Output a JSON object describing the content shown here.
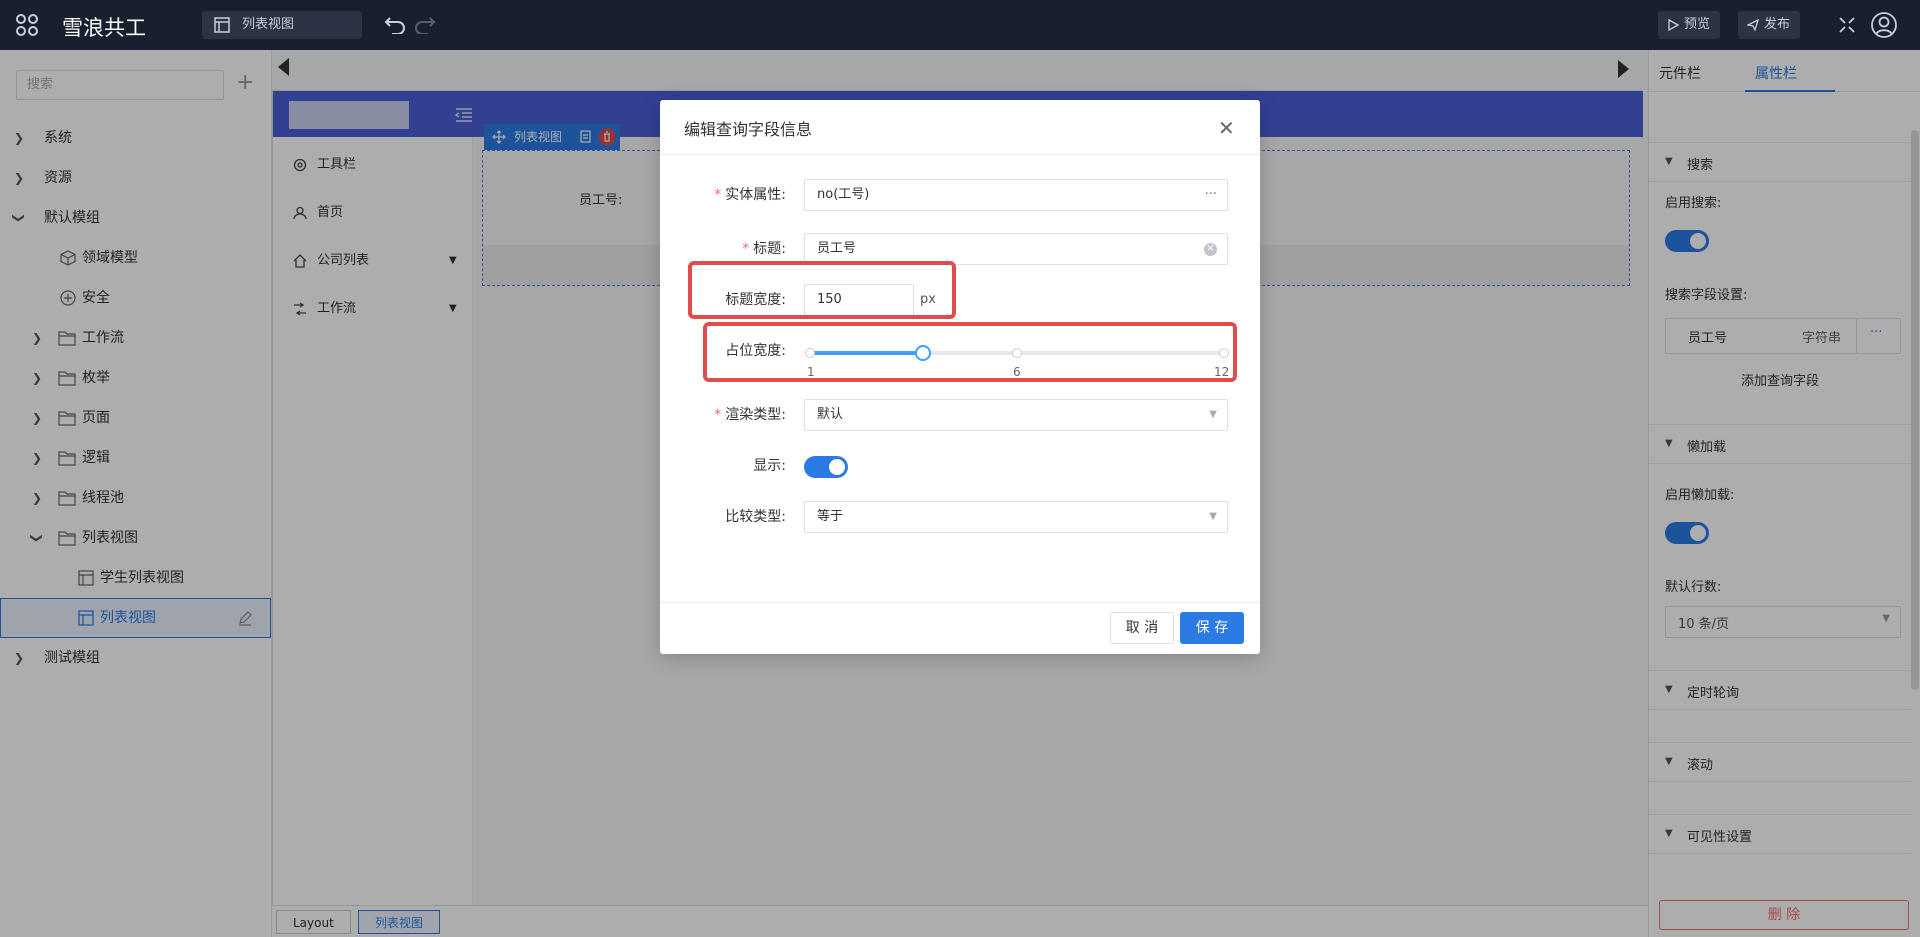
{
  "topbar": {
    "app_title": "雪浪共工",
    "tab_label": "列表视图",
    "preview_label": "预览",
    "publish_label": "发布"
  },
  "left": {
    "search_placeholder": "搜索",
    "tree": [
      {
        "label": "系统"
      },
      {
        "label": "资源"
      },
      {
        "label": "默认模组"
      },
      {
        "label": "领域模型"
      },
      {
        "label": "安全"
      },
      {
        "label": "工作流"
      },
      {
        "label": "枚举"
      },
      {
        "label": "页面"
      },
      {
        "label": "逻辑"
      },
      {
        "label": "线程池"
      },
      {
        "label": "列表视图"
      },
      {
        "label": "学生列表视图"
      },
      {
        "label": "列表视图"
      },
      {
        "label": "测试模组"
      }
    ]
  },
  "canvas": {
    "side_items": [
      "工具栏",
      "首页",
      "公司列表",
      "工作流"
    ],
    "selected_component": "列表视图",
    "field_label": "员工号:"
  },
  "breadcrumb": [
    "Layout",
    "列表视图"
  ],
  "right": {
    "tabs": [
      "元件栏",
      "属性栏"
    ],
    "sections": {
      "search": "搜索",
      "enable_search": "启用搜索:",
      "search_field_settings": "搜索字段设置:",
      "search_field_name": "员工号",
      "search_field_type": "字符串",
      "add_query_field": "添加查询字段",
      "lazy_load": "懒加载",
      "enable_lazy_load": "启用懒加载:",
      "default_rows": "默认行数:",
      "default_rows_value": "10 条/页",
      "timed_polling": "定时轮询",
      "scroll": "滚动",
      "visibility": "可见性设置"
    },
    "delete_label": "删 除"
  },
  "dialog": {
    "title": "编辑查询字段信息",
    "entity_label": "实体属性:",
    "entity_value": "no(工号)",
    "title_label": "标题:",
    "title_value": "员工号",
    "title_width_label": "标题宽度:",
    "title_width_value": "150",
    "title_width_unit": "px",
    "span_label": "占位宽度:",
    "span_min": "1",
    "span_mid": "6",
    "span_max": "12",
    "span_value": 4,
    "render_type_label": "渲染类型:",
    "render_type_value": "默认",
    "display_label": "显示:",
    "compare_type_label": "比较类型:",
    "compare_type_value": "等于",
    "cancel_label": "取 消",
    "save_label": "保 存"
  }
}
